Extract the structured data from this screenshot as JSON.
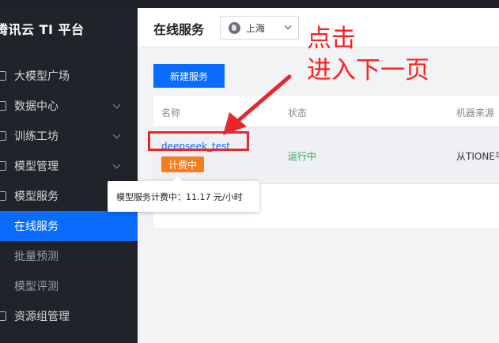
{
  "sidebar": {
    "brand": "腾讯云 TI 平台",
    "items": [
      {
        "label": "大模型广场",
        "icon": "cube-icon"
      },
      {
        "label": "数据中心",
        "icon": "database-icon"
      },
      {
        "label": "训练工坊",
        "icon": "monitor-icon"
      },
      {
        "label": "模型管理",
        "icon": "box-icon"
      },
      {
        "label": "模型服务",
        "icon": "service-icon"
      },
      {
        "label": "在线服务"
      },
      {
        "label": "批量预测"
      },
      {
        "label": "模型评测"
      },
      {
        "label": "资源组管理",
        "icon": "resource-icon"
      }
    ]
  },
  "header": {
    "title": "在线服务",
    "region": "上海"
  },
  "main": {
    "new_button": "新建服务",
    "columns": [
      "名称",
      "状态",
      "机器来源"
    ],
    "row": {
      "name": "deepseek_test",
      "billing_tag": "计费中",
      "status": "运行中",
      "source": "从TIONE平"
    }
  },
  "tooltip": "模型服务计费中：11.17 元/小时",
  "annotation": {
    "line1": "点击",
    "line2": "进入下一页"
  },
  "colors": {
    "accent": "#0a6cff",
    "highlight": "#e8262d",
    "running": "#27a85a",
    "billing": "#f57c1f"
  }
}
